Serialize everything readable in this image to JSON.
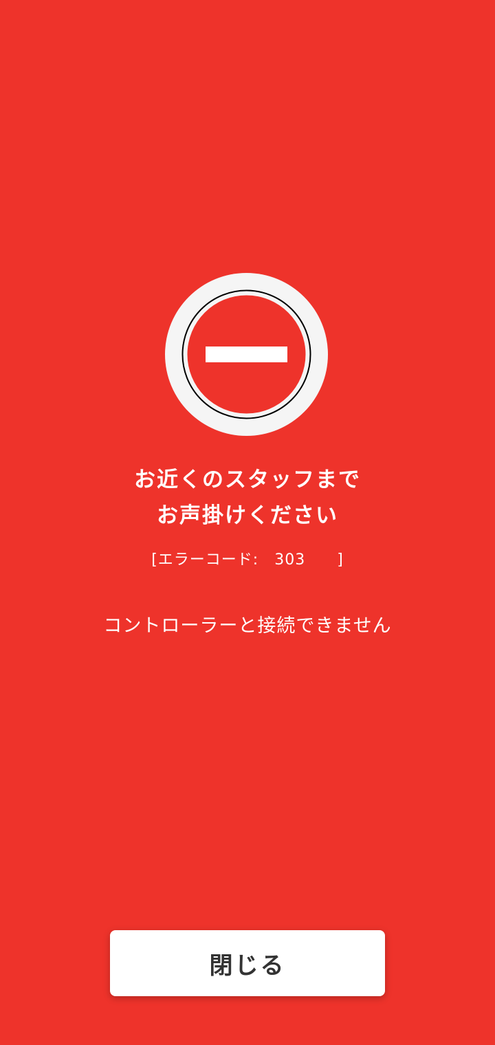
{
  "colors": {
    "background": "#ee332b",
    "icon_ring": "#f5f5f5",
    "icon_fill": "#ee332b",
    "text": "#ffffff",
    "button_bg": "#ffffff",
    "button_text": "#333333"
  },
  "icon": "no-entry-icon",
  "headline": {
    "line1": "お近くのスタッフまで",
    "line2": "お声掛けください"
  },
  "error_code": {
    "text": "[エラーコード:　303　　]"
  },
  "message": "コントローラーと接続できません",
  "close_button": {
    "label": "閉じる"
  }
}
